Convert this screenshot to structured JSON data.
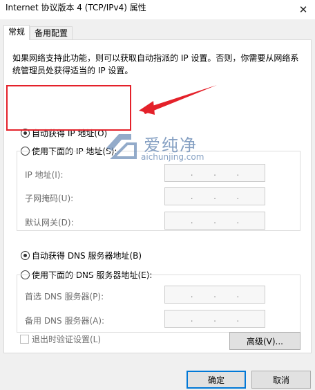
{
  "window": {
    "title": "Internet 协议版本 4 (TCP/IPv4) 属性",
    "close_glyph": "✕"
  },
  "tabs": [
    {
      "label": "常规",
      "active": true
    },
    {
      "label": "备用配置",
      "active": false
    }
  ],
  "description": "如果网络支持此功能，则可以获取自动指派的 IP 设置。否则，你需要从网络系统管理员处获得适当的 IP 设置。",
  "ip_section": {
    "auto_radio": "自动获得 IP 地址(O)",
    "manual_radio": "使用下面的 IP 地址(S):",
    "auto_checked": true,
    "fields": [
      {
        "label": "IP 地址(I):",
        "value": ".   .   ."
      },
      {
        "label": "子网掩码(U):",
        "value": ".   .   ."
      },
      {
        "label": "默认网关(D):",
        "value": ".   .   ."
      }
    ]
  },
  "dns_section": {
    "auto_radio": "自动获得 DNS 服务器地址(B)",
    "manual_radio": "使用下面的 DNS 服务器地址(E):",
    "auto_checked": true,
    "fields": [
      {
        "label": "首选 DNS 服务器(P):",
        "value": ".   .   ."
      },
      {
        "label": "备用 DNS 服务器(A):",
        "value": ".   .   ."
      }
    ]
  },
  "validate_checkbox": "退出时验证设置(L)",
  "buttons": {
    "advanced": "高级(V)...",
    "ok": "确定",
    "cancel": "取消"
  },
  "watermark": {
    "brand": "爱纯净",
    "site": "aichunjing.com"
  },
  "colors": {
    "annotation": "#e4212a",
    "default_button_border": "#0078d7"
  }
}
